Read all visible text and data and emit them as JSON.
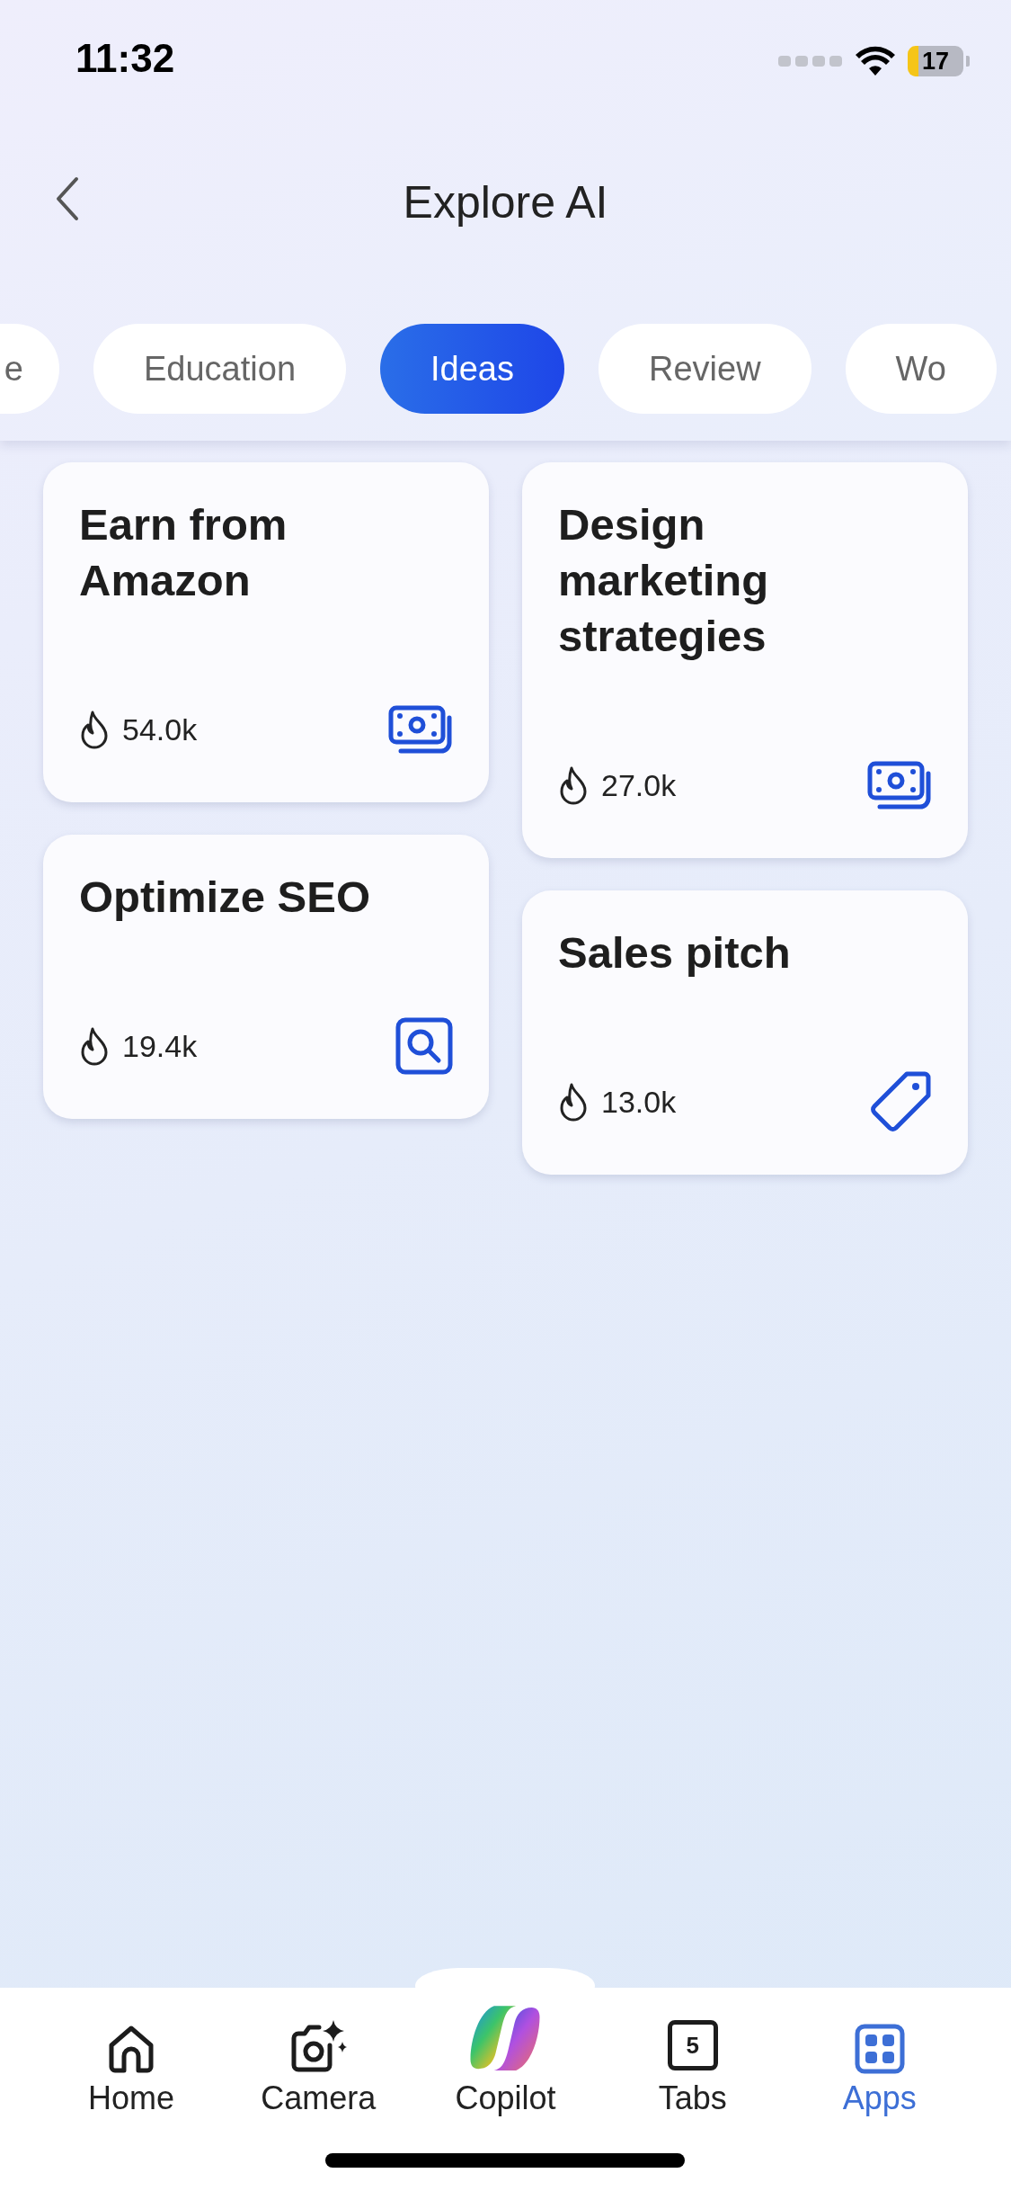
{
  "status_bar": {
    "time": "11:32",
    "battery": "17"
  },
  "header": {
    "title": "Explore AI"
  },
  "tabs": [
    {
      "label": "e",
      "selected": false
    },
    {
      "label": "Education",
      "selected": false
    },
    {
      "label": "Ideas",
      "selected": true
    },
    {
      "label": "Review",
      "selected": false
    },
    {
      "label": "Wo",
      "selected": false
    }
  ],
  "cards": [
    {
      "title": "Earn from Amazon",
      "count": "54.0k",
      "kind": "money"
    },
    {
      "title": "Design marketing strategies",
      "count": "27.0k",
      "kind": "money"
    },
    {
      "title": "Optimize SEO",
      "count": "19.4k",
      "kind": "search"
    },
    {
      "title": "Sales pitch",
      "count": "13.0k",
      "kind": "tag"
    }
  ],
  "nav": [
    {
      "label": "Home",
      "kind": "home",
      "selected": false
    },
    {
      "label": "Camera",
      "kind": "camera",
      "selected": false
    },
    {
      "label": "Copilot",
      "kind": "copilot",
      "selected": false
    },
    {
      "label": "Tabs",
      "kind": "tabs",
      "badge": "5",
      "selected": false
    },
    {
      "label": "Apps",
      "kind": "apps",
      "selected": true
    }
  ]
}
